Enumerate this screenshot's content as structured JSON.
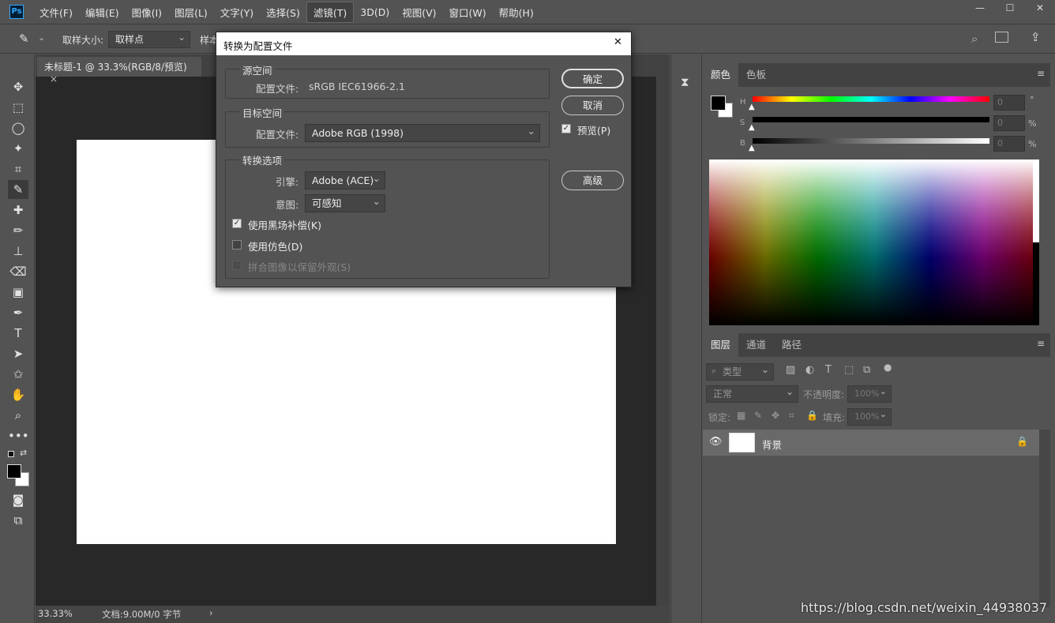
{
  "app": {
    "logo": "Ps"
  },
  "menu": [
    "文件(F)",
    "编辑(E)",
    "图像(I)",
    "图层(L)",
    "文字(Y)",
    "选择(S)",
    "滤镜(T)",
    "3D(D)",
    "视图(V)",
    "窗口(W)",
    "帮助(H)"
  ],
  "window_controls": {
    "minimize": "—",
    "maximize": "☐",
    "close": "✕"
  },
  "options": {
    "sample_size_label": "取样大小:",
    "sample_size_value": "取样点",
    "sample_label": "样本"
  },
  "document": {
    "tab_title": "未标题-1 @ 33.3%(RGB/8/预览)",
    "tab_close": "×",
    "zoom": "33.33%",
    "doc_info": "文档:9.00M/0 字节",
    "status_arrow": "›"
  },
  "color_panel": {
    "tabs": [
      "颜色",
      "色板"
    ],
    "sliders": [
      {
        "label": "H",
        "value": "0",
        "unit": "°"
      },
      {
        "label": "S",
        "value": "0",
        "unit": "%"
      },
      {
        "label": "B",
        "value": "0",
        "unit": "%"
      }
    ]
  },
  "layers_panel": {
    "tabs": [
      "图层",
      "通道",
      "路径"
    ],
    "filter_label": "类型",
    "blend_mode": "正常",
    "opacity_label": "不透明度:",
    "opacity_value": "100%",
    "lock_label": "锁定:",
    "fill_label": "填充:",
    "fill_value": "100%",
    "layers": [
      {
        "name": "背景"
      }
    ]
  },
  "dialog": {
    "title": "转换为配置文件",
    "close": "✕",
    "source": {
      "group_title": "源空间",
      "profile_label": "配置文件:",
      "profile_value": "sRGB IEC61966-2.1"
    },
    "destination": {
      "group_title": "目标空间",
      "profile_label": "配置文件:",
      "profile_value": "Adobe RGB (1998)"
    },
    "conversion": {
      "group_title": "转换选项",
      "engine_label": "引擎:",
      "engine_value": "Adobe (ACE)",
      "intent_label": "意图:",
      "intent_value": "可感知",
      "black_point": {
        "label": "使用黑场补偿(K)",
        "checked": true
      },
      "dither": {
        "label": "使用仿色(D)",
        "checked": false
      },
      "flatten": {
        "label": "拼合图像以保留外观(S)",
        "checked": false,
        "disabled": true
      }
    },
    "buttons": {
      "ok": "确定",
      "cancel": "取消",
      "advanced": "高级"
    },
    "preview": {
      "label": "预览(P)",
      "checked": true
    }
  },
  "watermark": "https://blog.csdn.net/weixin_44938037"
}
